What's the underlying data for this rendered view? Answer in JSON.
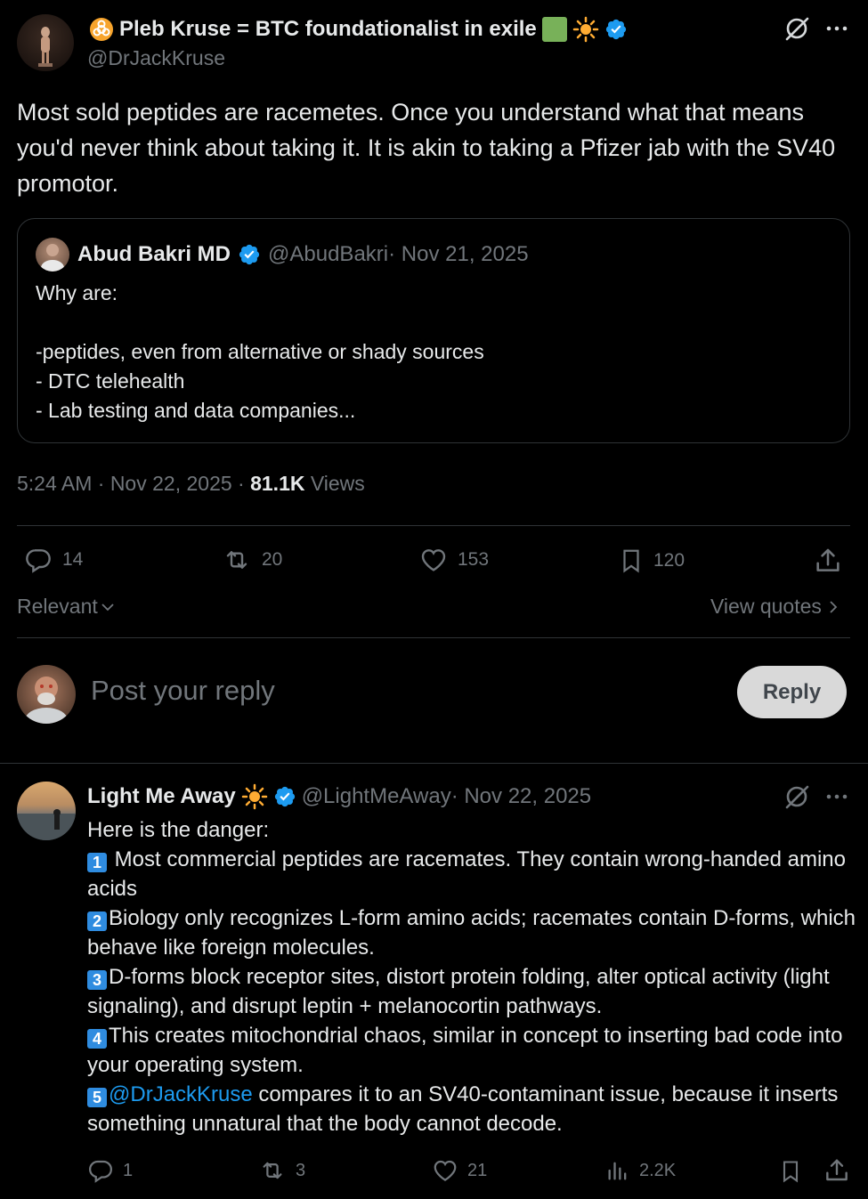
{
  "tweet": {
    "author_name": "Pleb Kruse = BTC foundationalist in exile",
    "author_handle": "@DrJackKruse",
    "text": "Most sold peptides are racemetes.  Once you understand what that means you'd never think about taking it.  It is akin to taking a Pfizer jab with the SV40 promotor.",
    "time": "5:24 AM · Nov 22, 2025 · ",
    "views_count": "81.1K",
    "views_label": " Views",
    "stats": {
      "replies": "14",
      "reposts": "20",
      "likes": "153",
      "bookmarks": "120"
    }
  },
  "quote": {
    "author_name": "Abud Bakri MD",
    "author_handle": "@AbudBakri",
    "date": " · Nov 21, 2025",
    "text": "Why are:\n\n-peptides, even from alternative or shady sources\n- DTC telehealth\n- Lab testing and data companies..."
  },
  "sort": {
    "label": "Relevant",
    "view_quotes": "View quotes"
  },
  "composer": {
    "placeholder": "Post your reply",
    "button": "Reply"
  },
  "reply": {
    "author_name": "Light Me Away",
    "author_handle": "@LightMeAway",
    "date": " · Nov 22, 2025",
    "intro": "Here is the danger:",
    "points": [
      {
        "num": "1",
        "text": " Most commercial peptides are racemates. They contain wrong-handed amino acids"
      },
      {
        "num": "2",
        "text": "Biology only recognizes L-form amino acids; racemates contain D-forms, which behave like foreign molecules."
      },
      {
        "num": "3",
        "text": "D-forms block receptor sites, distort protein folding, alter optical activity (light signaling), and disrupt leptin + melanocortin pathways."
      },
      {
        "num": "4",
        "text": "This creates mitochondrial chaos, similar in concept to inserting bad code into your operating system."
      },
      {
        "num": "5",
        "mention": "@DrJackKruse",
        "text": " compares it to an SV40-contaminant issue, because it inserts something unnatural that the body cannot decode."
      }
    ],
    "stats": {
      "replies": "1",
      "reposts": "3",
      "likes": "21",
      "views": "2.2K"
    }
  },
  "colors": {
    "accent": "#1d9bf0",
    "muted": "#71767b",
    "border": "#2f3336"
  }
}
